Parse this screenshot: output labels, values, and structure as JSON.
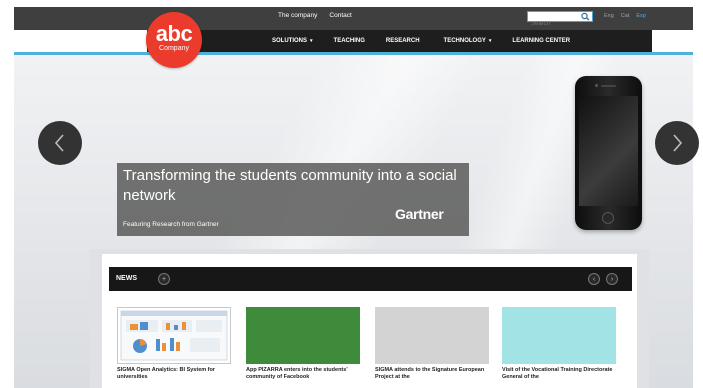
{
  "header": {
    "util_links": [
      "The company",
      "Contact"
    ],
    "search": {
      "placeholder": "Search"
    },
    "languages": [
      "Eng",
      "Cat",
      "Esp"
    ],
    "logo": {
      "main": "abc",
      "sub": "Company"
    },
    "nav": [
      {
        "label": "SOLUTIONS",
        "has_dropdown": true
      },
      {
        "label": "TEACHING",
        "has_dropdown": false
      },
      {
        "label": "RESEARCH",
        "has_dropdown": false
      },
      {
        "label": "TECHNOLOGY",
        "has_dropdown": true
      },
      {
        "label": "LEARNING CENTER",
        "has_dropdown": false
      }
    ]
  },
  "hero": {
    "headline": "Transforming the students community into a social network",
    "subtitle": "Featuring Research from Gartner",
    "brand": "Gartner",
    "prev_icon": "chevron-left-icon",
    "next_icon": "chevron-right-icon"
  },
  "news": {
    "title": "NEWS",
    "items": [
      {
        "text": "SIGMA Open Analytics: BI System for universities"
      },
      {
        "text": "App PIZARRA enters into the students' community of Facebook"
      },
      {
        "text": "SIGMA attends to the Signature European Project at the"
      },
      {
        "text": "Visit of the Vocational Training Directorate General of the"
      }
    ]
  },
  "colors": {
    "accent": "#4fb0d9",
    "logo_red": "#ea3b2c",
    "nav_dark": "#1e1e1e",
    "thumb_green": "#3e8b3c",
    "thumb_grey": "#d3d3d3",
    "thumb_cyan": "#a2e3e6"
  }
}
